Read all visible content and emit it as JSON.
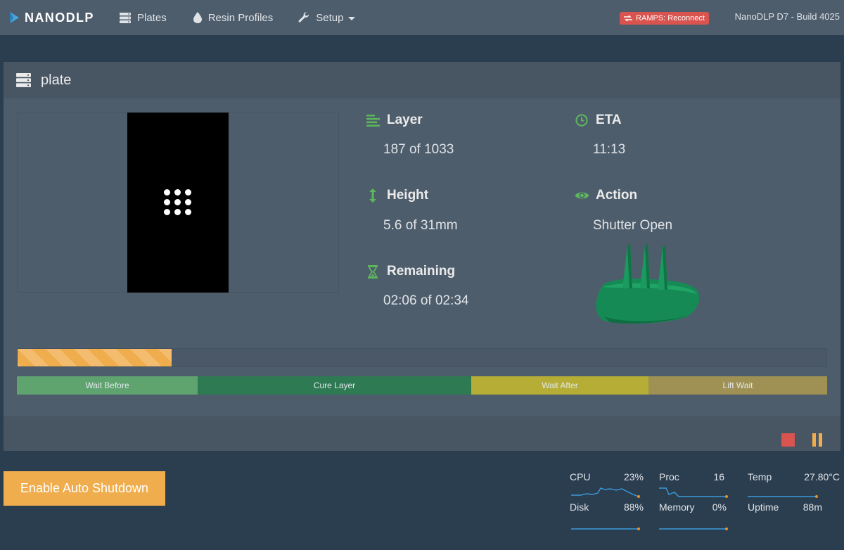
{
  "navbar": {
    "brand": "NANODLP",
    "items": [
      {
        "label": "Plates",
        "icon": "server-icon"
      },
      {
        "label": "Resin Profiles",
        "icon": "tint-icon"
      },
      {
        "label": "Setup",
        "icon": "wrench-icon"
      }
    ],
    "ramps_badge": "RAMPS: Reconnect",
    "version": "NanoDLP D7 - Build 4025"
  },
  "panel": {
    "title": "plate",
    "layer": {
      "label": "Layer",
      "value": "187 of 1033"
    },
    "height": {
      "label": "Height",
      "value": "5.6 of 31mm"
    },
    "remaining": {
      "label": "Remaining",
      "value": "02:06 of 02:34"
    },
    "eta": {
      "label": "ETA",
      "value": "11:13"
    },
    "action": {
      "label": "Action",
      "value": "Shutter Open"
    },
    "progress_fraction": 0.19,
    "phases": [
      "Wait Before",
      "Cure Layer",
      "Wait After",
      "Lift Wait"
    ]
  },
  "bottom": {
    "shutdown_label": "Enable Auto Shutdown",
    "metrics": {
      "cpu": {
        "label": "CPU",
        "value": "23%"
      },
      "proc": {
        "label": "Proc",
        "value": "16"
      },
      "temp": {
        "label": "Temp",
        "value": "27.80°C"
      },
      "disk": {
        "label": "Disk",
        "value": "88%"
      },
      "memory": {
        "label": "Memory",
        "value": "0%"
      },
      "uptime": {
        "label": "Uptime",
        "value": "88m"
      }
    }
  },
  "colors": {
    "accent_green": "#5cb85c",
    "warning": "#f0ad4e",
    "danger": "#d9534f",
    "navbar": "#4e5d6c",
    "background": "#2b3e50"
  }
}
